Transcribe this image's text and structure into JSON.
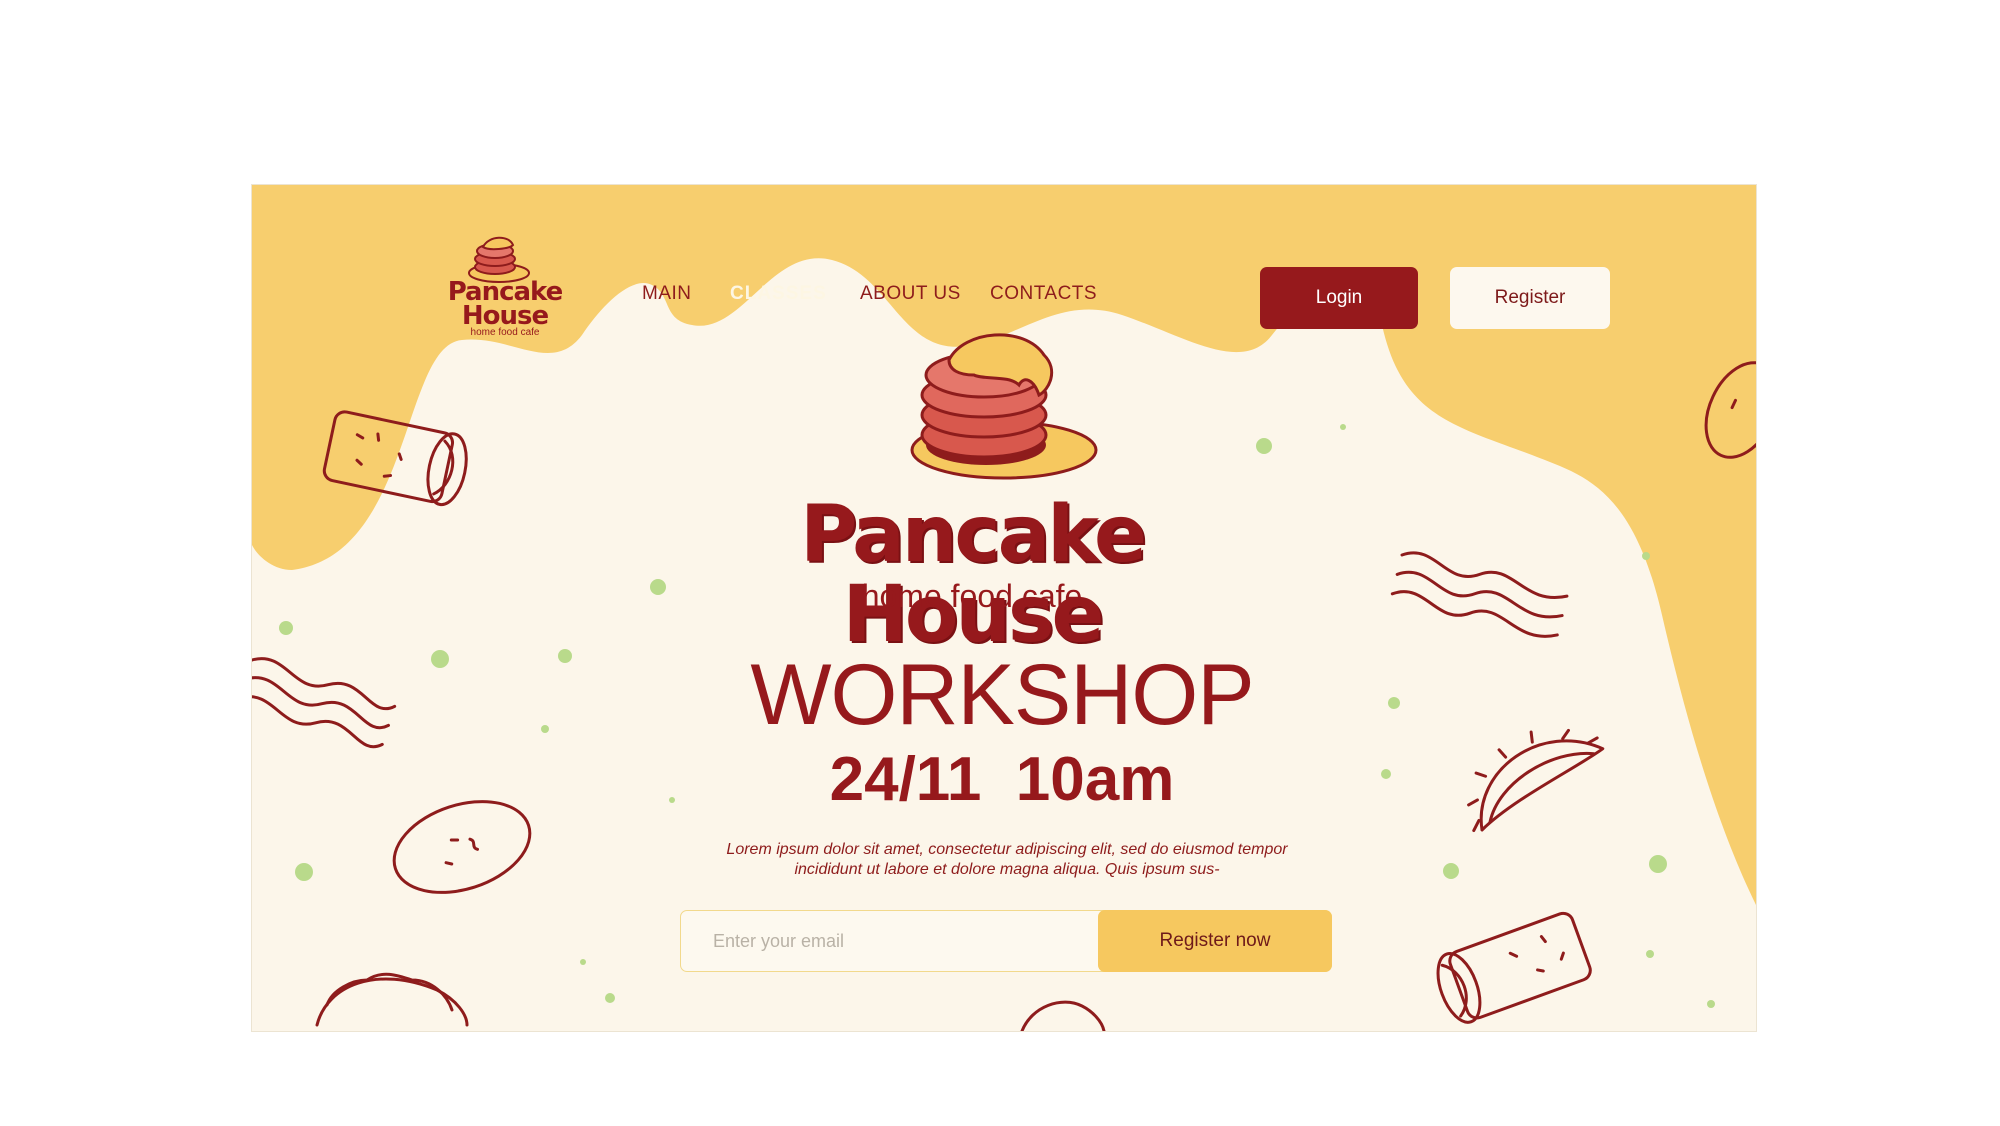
{
  "colors": {
    "brand_red": "#96191c",
    "accent_yellow": "#f6c85f",
    "cream": "#fcf6ea",
    "dot_green": "#b8d98a"
  },
  "header": {
    "logo": {
      "name": "Pancake House",
      "tagline": "home food cafe",
      "icon": "pancake-stack-icon"
    },
    "nav": [
      {
        "label": "MAIN",
        "active": false
      },
      {
        "label": "CLASSES",
        "active": true
      },
      {
        "label": "ABOUT US",
        "active": false
      },
      {
        "label": "CONTACTS",
        "active": false
      }
    ],
    "login_label": "Login",
    "register_label": "Register"
  },
  "hero": {
    "logo": {
      "name": "Pancake House",
      "tagline": "home food cafe",
      "icon": "pancake-stack-icon"
    },
    "title": "WORKSHOP",
    "datetime": "24/11  10am",
    "description": "Lorem ipsum dolor sit amet, consectetur adipiscing elit, sed do eiusmod tempor incididunt ut labore et dolore magna aliqua. Quis ipsum sus-",
    "email_placeholder": "Enter your email",
    "cta_label": "Register now"
  },
  "decorations": [
    "burrito-icon",
    "bacon-icon",
    "tortilla-icon",
    "dumpling-icon",
    "taco-icon"
  ]
}
